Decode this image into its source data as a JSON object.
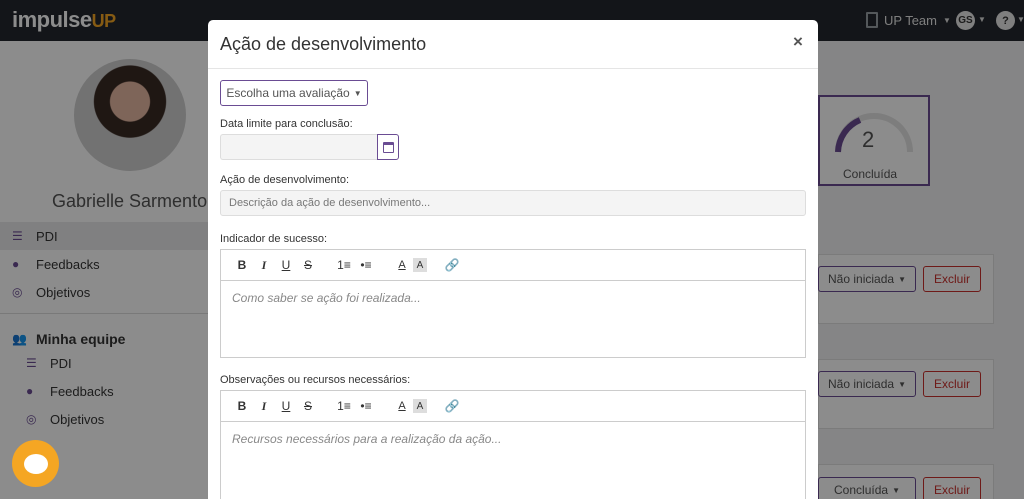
{
  "app": {
    "logo_main": "impulse",
    "logo_accent": "UP",
    "team_label": "UP Team",
    "user_initials": "GS",
    "help_label": "?"
  },
  "sidebar": {
    "user_name": "Gabrielle Sarmento",
    "items": [
      {
        "label": "PDI",
        "icon": "list-icon"
      },
      {
        "label": "Feedbacks",
        "icon": "chat-icon"
      },
      {
        "label": "Objetivos",
        "icon": "target-icon"
      }
    ],
    "team_heading": "Minha equipe",
    "team_items": [
      {
        "label": "PDI",
        "icon": "list-icon"
      },
      {
        "label": "Feedbacks",
        "icon": "chat-icon"
      },
      {
        "label": "Objetivos",
        "icon": "target-icon"
      }
    ]
  },
  "summary": {
    "count": "2",
    "label": "Concluída"
  },
  "rows": [
    {
      "status": "Não iniciada",
      "delete": "Excluir"
    },
    {
      "status": "Não iniciada",
      "delete": "Excluir"
    },
    {
      "status": "Concluída",
      "delete": "Excluir"
    }
  ],
  "modal": {
    "title": "Ação de desenvolvimento",
    "close": "×",
    "evaluation_button": "Escolha uma avaliação",
    "date_label": "Data limite para conclusão:",
    "action_label": "Ação de desenvolvimento:",
    "action_placeholder": "Descrição da ação de desenvolvimento...",
    "success_label": "Indicador de sucesso:",
    "success_placeholder": "Como saber se ação foi realizada...",
    "resources_label": "Observações ou recursos necessários:",
    "resources_placeholder": "Recursos necessários para a realização da ação..."
  },
  "toolbar": {
    "bold": "B",
    "italic": "I",
    "underline": "U",
    "strike": "S",
    "ordered_list": "1≡",
    "bullet_list": "•≡",
    "font_color": "A",
    "bg_color": "A",
    "link": "🔗"
  },
  "colors": {
    "accent": "#6a4c93",
    "brand_orange": "#f5a623",
    "danger": "#c9302c",
    "topbar": "#23272e"
  }
}
